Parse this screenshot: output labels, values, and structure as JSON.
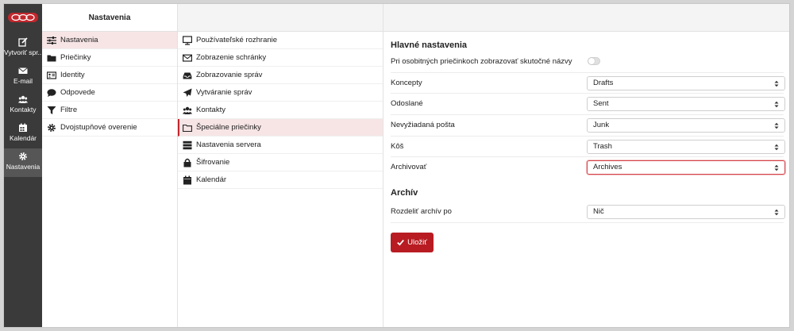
{
  "nav": {
    "items": [
      {
        "label": "Vytvoriť spr...",
        "icon": "compose-icon"
      },
      {
        "label": "E-mail",
        "icon": "envelope-icon"
      },
      {
        "label": "Kontakty",
        "icon": "users-icon"
      },
      {
        "label": "Kalendár",
        "icon": "calendar-icon"
      },
      {
        "label": "Nastavenia",
        "icon": "gear-icon"
      }
    ],
    "active": "Nastavenia"
  },
  "settings_menu": {
    "title": "Nastavenia",
    "items": [
      {
        "label": "Nastavenia",
        "icon": "sliders-icon"
      },
      {
        "label": "Priečinky",
        "icon": "folder-icon"
      },
      {
        "label": "Identity",
        "icon": "id-card-icon"
      },
      {
        "label": "Odpovede",
        "icon": "comment-icon"
      },
      {
        "label": "Filtre",
        "icon": "filter-icon"
      },
      {
        "label": "Dvojstupňové overenie",
        "icon": "gear-icon"
      }
    ],
    "selected": "Nastavenia"
  },
  "sections": {
    "items": [
      {
        "label": "Používateľské rozhranie",
        "icon": "monitor-icon"
      },
      {
        "label": "Zobrazenie schránky",
        "icon": "envelope-icon"
      },
      {
        "label": "Zobrazovanie správ",
        "icon": "inbox-icon"
      },
      {
        "label": "Vytváranie správ",
        "icon": "paper-plane-icon"
      },
      {
        "label": "Kontakty",
        "icon": "users-icon"
      },
      {
        "label": "Špeciálne priečinky",
        "icon": "folder-open-icon"
      },
      {
        "label": "Nastavenia servera",
        "icon": "server-icon"
      },
      {
        "label": "Šifrovanie",
        "icon": "lock-icon"
      },
      {
        "label": "Kalendár",
        "icon": "calendar-icon"
      }
    ],
    "selected": "Špeciálne priečinky"
  },
  "form": {
    "main_title": "Hlavné nastavenia",
    "toggle_label": "Pri osobitných priečinkoch zobrazovať skutočné názvy",
    "toggle_on": false,
    "rows": [
      {
        "label": "Koncepty",
        "value": "Drafts"
      },
      {
        "label": "Odoslané",
        "value": "Sent"
      },
      {
        "label": "Nevyžiadaná pošta",
        "value": "Junk"
      },
      {
        "label": "Kôš",
        "value": "Trash"
      },
      {
        "label": "Archivovať",
        "value": "Archives"
      }
    ],
    "archive_title": "Archív",
    "archive_row": {
      "label": "Rozdeliť archív po",
      "value": "Nič"
    },
    "save_label": "Uložiť"
  },
  "colors": {
    "accent": "#b81c22",
    "nav_bg": "#3a3a3a",
    "selected_bg": "#f7e5e6"
  }
}
